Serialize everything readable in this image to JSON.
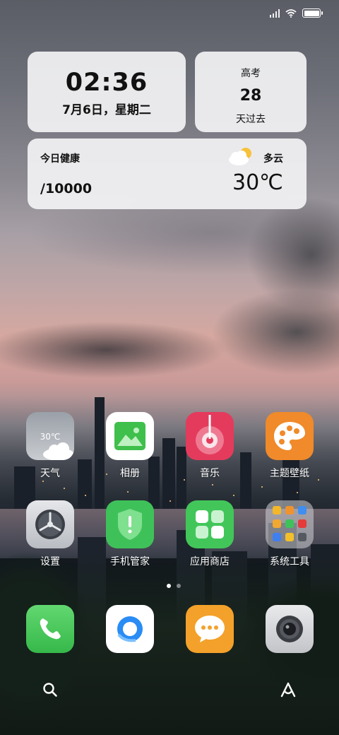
{
  "status_bar": {
    "signal_icon": "signal-icon",
    "wifi_icon": "wifi-icon",
    "battery_icon": "battery-icon"
  },
  "clock_widget": {
    "time": "02:36",
    "date": "7月6日，星期二"
  },
  "exam_widget": {
    "title": "高考",
    "days": "28",
    "suffix": "天过去"
  },
  "health_weather_widget": {
    "health_label": "今日健康",
    "steps": "/10000",
    "weather_condition": "多云",
    "temperature": "30℃",
    "weather_icon": "partly-cloudy-icon"
  },
  "apps_row1": [
    {
      "label": "天气",
      "icon": "weather-app-icon",
      "icon_text": "30℃"
    },
    {
      "label": "相册",
      "icon": "gallery-app-icon"
    },
    {
      "label": "音乐",
      "icon": "music-app-icon"
    },
    {
      "label": "主题壁纸",
      "icon": "theme-app-icon"
    }
  ],
  "apps_row2": [
    {
      "label": "设置",
      "icon": "settings-app-icon"
    },
    {
      "label": "手机管家",
      "icon": "security-app-icon"
    },
    {
      "label": "应用商店",
      "icon": "app-store-icon"
    },
    {
      "label": "系统工具",
      "icon": "system-tools-folder-icon"
    }
  ],
  "page_indicator": {
    "pages": 2,
    "current": 1
  },
  "dock": [
    {
      "icon": "phone-app-icon"
    },
    {
      "icon": "browser-app-icon"
    },
    {
      "icon": "messages-app-icon"
    },
    {
      "icon": "camera-app-icon"
    }
  ],
  "bottom_bar": {
    "left_icon": "search-icon",
    "right_icon": "assistant-icon"
  },
  "colors": {
    "widget_bg": "#f2f2f4",
    "gallery_green": "#3fbf4b",
    "music_red": "#e43b5c",
    "theme_orange": "#f08a2a",
    "security_green": "#3fc15a",
    "store_green": "#42c65a",
    "phone_green": "#44c755",
    "browser_blue": "#2a8cf5",
    "messages_orange": "#f3a12a"
  }
}
